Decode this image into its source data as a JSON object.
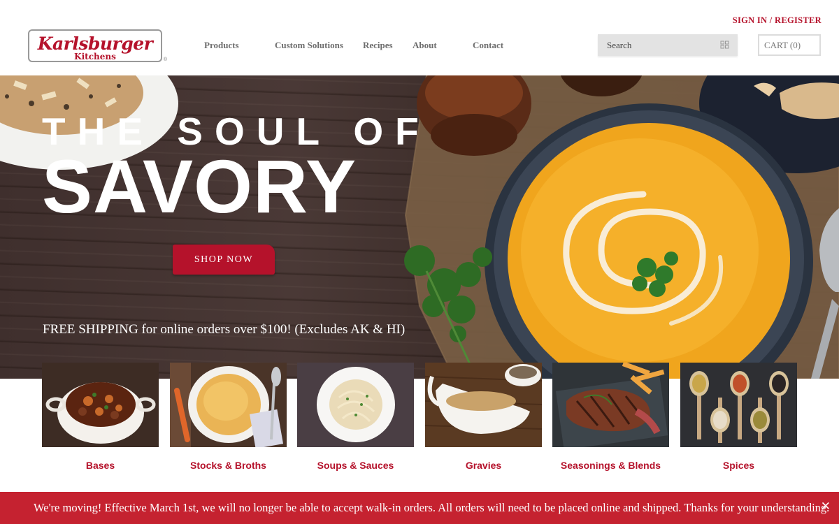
{
  "header": {
    "signin_label": "SIGN IN / REGISTER",
    "logo": {
      "brand": "Karlsburger",
      "sub": "Kitchens",
      "reg": "®"
    },
    "nav": [
      "Products",
      "Custom Solutions",
      "Recipes",
      "About",
      "Contact"
    ],
    "search": {
      "placeholder": "Search",
      "icon": "search-icon"
    },
    "cart_label": "CART (0)"
  },
  "hero": {
    "line1": "THE SOUL OF",
    "line2": "SAVORY",
    "cta_label": "SHOP NOW",
    "shipping_note": "FREE SHIPPING for online orders over $100! (Excludes AK & HI)"
  },
  "categories": [
    {
      "label": "Bases"
    },
    {
      "label": "Stocks & Broths"
    },
    {
      "label": "Soups & Sauces"
    },
    {
      "label": "Gravies"
    },
    {
      "label": "Seasonings & Blends"
    },
    {
      "label": "Spices"
    }
  ],
  "banner": {
    "message": "We're moving! Effective March 1st, we will no longer be able to accept walk-in orders. All orders will need to be placed online and shipped. Thanks for your understanding.",
    "close_symbol": "✕"
  },
  "colors": {
    "brand_red": "#b5122b",
    "banner_red": "#c52230",
    "nav_gray": "#6e6e6e"
  }
}
